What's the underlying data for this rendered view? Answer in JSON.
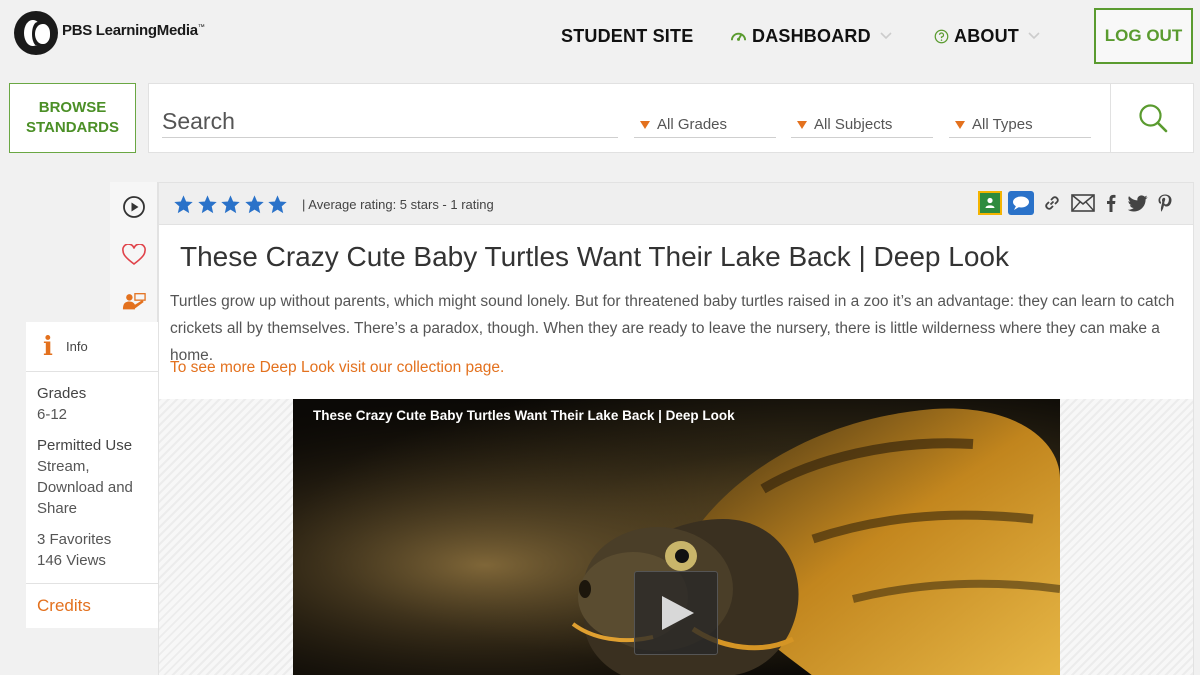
{
  "brand": {
    "logo_text": "PBS LearningMedia",
    "trademark": "™"
  },
  "nav": {
    "student_site": "STUDENT SITE",
    "dashboard": "DASHBOARD",
    "about": "ABOUT",
    "logout": "LOG OUT"
  },
  "search": {
    "browse_line1": "BROWSE",
    "browse_line2": "STANDARDS",
    "placeholder": "Search",
    "grades": "All Grades",
    "subjects": "All Subjects",
    "types": "All Types"
  },
  "rating": {
    "stars": 5,
    "text": "| Average rating: 5 stars - 1 rating"
  },
  "resource": {
    "title": "These Crazy Cute Baby Turtles Want Their Lake Back | Deep Look",
    "description": "Turtles grow up without parents, which might sound lonely. But for threatened baby turtles raised in a zoo it’s an advantage: they can learn to catch crickets all by themselves. There’s a paradox, though. When they are ready to leave the nursery, there is little wilderness where they can make a home.",
    "collection_link": "To see more Deep Look visit our collection page."
  },
  "video": {
    "title": "These Crazy Cute Baby Turtles Want Their Lake Back | Deep Look"
  },
  "info": {
    "tab_label": "Info",
    "grades_label": "Grades",
    "grades_value": "6-12",
    "permitted_label": "Permitted Use",
    "permitted_value_1": "Stream,",
    "permitted_value_2": "Download and",
    "permitted_value_3": "Share",
    "favorites": "3 Favorites",
    "views": "146 Views",
    "credits": "Credits"
  },
  "colors": {
    "brand_green": "#5a9b2f",
    "accent_orange": "#e3711e",
    "star_blue": "#2a72c9"
  },
  "icons": [
    "pbs-logo-icon",
    "dashboard-gauge-icon",
    "about-help-icon",
    "chevron-down-icon",
    "search-icon",
    "play-circle-icon",
    "heart-icon",
    "teacher-icon",
    "info-icon",
    "star-icon",
    "google-classroom-icon",
    "comment-icon",
    "link-icon",
    "email-icon",
    "facebook-icon",
    "twitter-icon",
    "pinterest-icon",
    "play-icon"
  ]
}
